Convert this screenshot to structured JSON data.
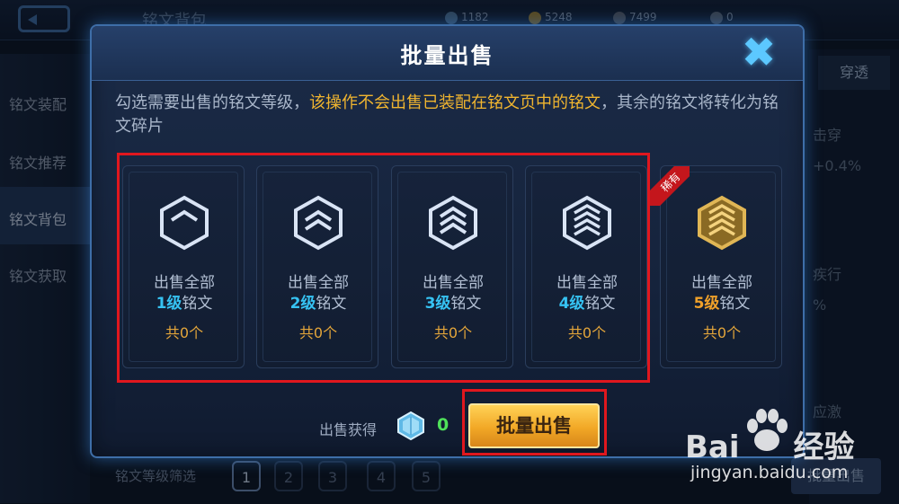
{
  "background": {
    "title": "铭文背包",
    "resources": [
      "1182",
      "5248",
      "7499",
      "0"
    ],
    "sidebar": [
      "铭文装配",
      "铭文推荐",
      "铭文背包",
      "铭文获取"
    ],
    "right_tab": "穿透",
    "right_texts": [
      "击穿",
      "+0.4%",
      "疾行",
      "%",
      "应激"
    ],
    "filter_label": "铭文等级筛选",
    "filter_levels": [
      "1",
      "2",
      "3",
      "4",
      "5"
    ],
    "bottom_right_button": "批量出售"
  },
  "modal": {
    "title": "批量出售",
    "close_icon": "✖",
    "description_part1": "勾选需要出售的铭文等级，",
    "description_warn": "该操作不会出售已装配在铭文页中的铭文",
    "description_part2": "，其余的铭文将转化为铭文碎片",
    "cards": [
      {
        "line1": "出售全部",
        "level": "1级",
        "suffix": "铭文",
        "count": "共0个"
      },
      {
        "line1": "出售全部",
        "level": "2级",
        "suffix": "铭文",
        "count": "共0个"
      },
      {
        "line1": "出售全部",
        "level": "3级",
        "suffix": "铭文",
        "count": "共0个"
      },
      {
        "line1": "出售全部",
        "level": "4级",
        "suffix": "铭文",
        "count": "共0个"
      },
      {
        "line1": "出售全部",
        "level": "5级",
        "suffix": "铭文",
        "count": "共0个"
      }
    ],
    "rare_tag": "稀有",
    "gain_label": "出售获得",
    "gain_value": "0",
    "sell_button": "批量出售"
  },
  "watermark": {
    "logo_text": "Bai",
    "logo_du": "du",
    "logo_cn": "经验",
    "url": "jingyan.baidu.com"
  },
  "colors": {
    "accent_blue": "#36c2f2",
    "warn_gold": "#f1b52f",
    "highlight_red": "#e0171e",
    "gain_green": "#4fe15a"
  }
}
